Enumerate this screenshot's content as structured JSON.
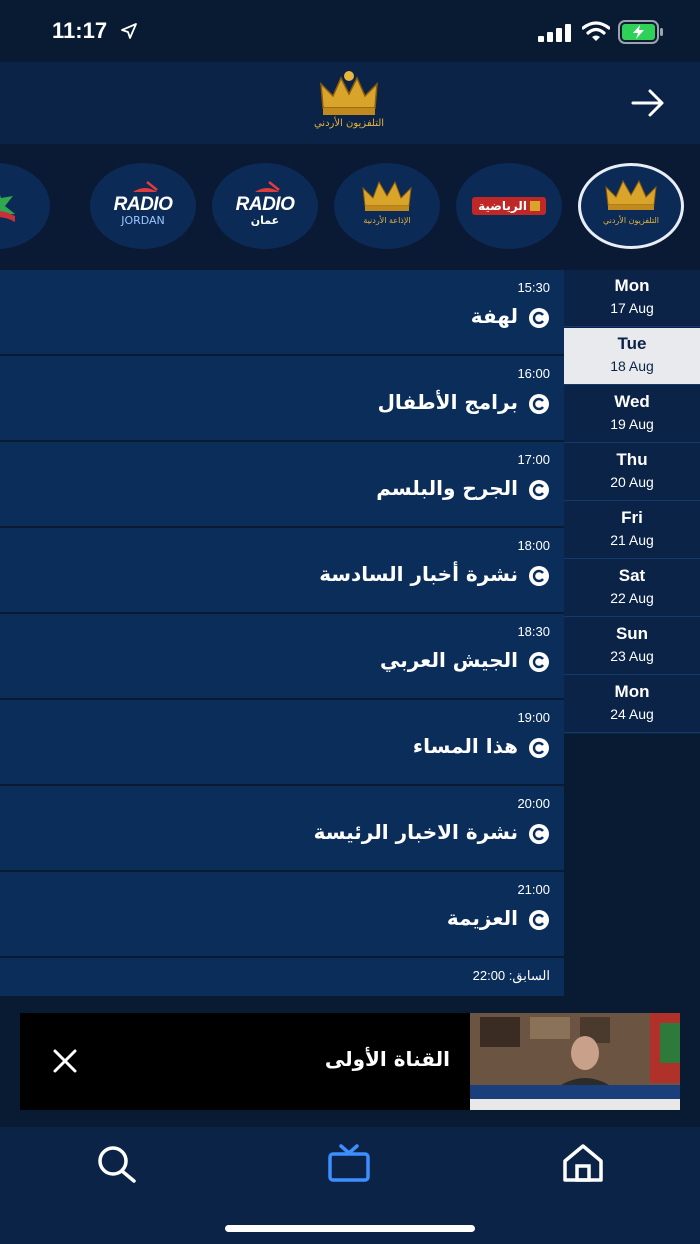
{
  "status_bar": {
    "time": "11:17"
  },
  "header": {
    "logo": "jordan-tv-crown-logo",
    "back_icon": "arrow-right-icon"
  },
  "channels": [
    {
      "id": "jordan-tv",
      "label": "التلفزيون الأردني",
      "selected": true
    },
    {
      "id": "sports",
      "label": "الرياضية",
      "selected": false
    },
    {
      "id": "jordan-radio",
      "label": "الإذاعة الأردنية",
      "selected": false
    },
    {
      "id": "radio-amman",
      "label": "RADIO",
      "sub": "عمان",
      "selected": false
    },
    {
      "id": "radio-jordan",
      "label": "RADIO",
      "sub": "JORDAN",
      "selected": false
    },
    {
      "id": "quran",
      "label": "",
      "selected": false
    }
  ],
  "schedule": [
    {
      "time": "15:30",
      "title": "لهفة"
    },
    {
      "time": "16:00",
      "title": "برامج الأطفال"
    },
    {
      "time": "17:00",
      "title": "الجرح والبلسم"
    },
    {
      "time": "18:00",
      "title": "نشرة أخبار السادسة"
    },
    {
      "time": "18:30",
      "title": "الجيش العربي"
    },
    {
      "time": "19:00",
      "title": "هذا المساء"
    },
    {
      "time": "20:00",
      "title": "نشرة الاخبار الرئيسة"
    },
    {
      "time": "21:00",
      "title": "العزيمة"
    },
    {
      "time": "السابق: 22:00",
      "title": ""
    }
  ],
  "days": [
    {
      "name": "Mon",
      "date": "17 Aug",
      "active": false
    },
    {
      "name": "Tue",
      "date": "18 Aug",
      "active": true
    },
    {
      "name": "Wed",
      "date": "19 Aug",
      "active": false
    },
    {
      "name": "Thu",
      "date": "20 Aug",
      "active": false
    },
    {
      "name": "Fri",
      "date": "21 Aug",
      "active": false
    },
    {
      "name": "Sat",
      "date": "22 Aug",
      "active": false
    },
    {
      "name": "Sun",
      "date": "23 Aug",
      "active": false
    },
    {
      "name": "Mon",
      "date": "24 Aug",
      "active": false
    }
  ],
  "mini_player": {
    "title": "القناة الأولى"
  },
  "tabs": [
    {
      "id": "search",
      "icon": "search-icon"
    },
    {
      "id": "tv",
      "icon": "tv-icon",
      "active": true
    },
    {
      "id": "home",
      "icon": "home-icon"
    }
  ],
  "colors": {
    "background": "#091a33",
    "panel": "#0b2d5a",
    "accent": "#3d8eff",
    "active_day": "#e9eaed"
  }
}
